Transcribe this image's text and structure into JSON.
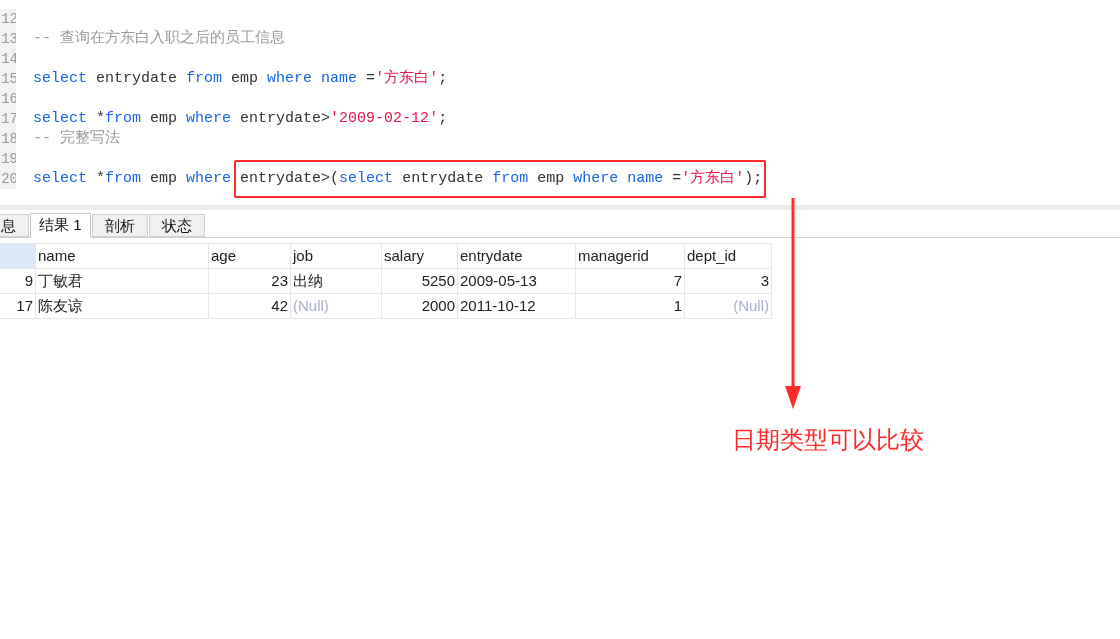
{
  "editor": {
    "lines": [
      {
        "number": "12"
      },
      {
        "number": "13",
        "tokens": [
          {
            "kind": "comment",
            "text": "-- 查询在方东白入职之后的员工信息"
          }
        ]
      },
      {
        "number": "14"
      },
      {
        "number": "15",
        "tokens": [
          {
            "kind": "keyword",
            "text": "select"
          },
          {
            "kind": "plain",
            "text": " entrydate "
          },
          {
            "kind": "keyword",
            "text": "from"
          },
          {
            "kind": "plain",
            "text": " emp "
          },
          {
            "kind": "keyword",
            "text": "where"
          },
          {
            "kind": "keyword",
            "text": " name"
          },
          {
            "kind": "plain",
            "text": " ="
          },
          {
            "kind": "string",
            "text": "'方东白'"
          },
          {
            "kind": "plain",
            "text": ";"
          }
        ]
      },
      {
        "number": "16"
      },
      {
        "number": "17",
        "tokens": [
          {
            "kind": "keyword",
            "text": "select"
          },
          {
            "kind": "plain",
            "text": " *"
          },
          {
            "kind": "keyword",
            "text": "from"
          },
          {
            "kind": "plain",
            "text": " emp "
          },
          {
            "kind": "keyword",
            "text": "where"
          },
          {
            "kind": "plain",
            "text": " entrydate>"
          },
          {
            "kind": "string",
            "text": "'2009-02-12'"
          },
          {
            "kind": "plain",
            "text": ";"
          }
        ]
      },
      {
        "number": "18",
        "tokens": [
          {
            "kind": "comment",
            "text": "-- 完整写法"
          }
        ]
      },
      {
        "number": "19"
      },
      {
        "number": "20",
        "tokens": [
          {
            "kind": "keyword",
            "text": "select"
          },
          {
            "kind": "plain",
            "text": " *"
          },
          {
            "kind": "keyword",
            "text": "from"
          },
          {
            "kind": "plain",
            "text": " emp "
          },
          {
            "kind": "keyword",
            "text": "where "
          }
        ],
        "boxed_tokens": [
          {
            "kind": "plain",
            "text": "entrydate>("
          },
          {
            "kind": "keyword",
            "text": "select"
          },
          {
            "kind": "plain",
            "text": " entrydate "
          },
          {
            "kind": "keyword",
            "text": "from"
          },
          {
            "kind": "plain",
            "text": " emp "
          },
          {
            "kind": "keyword",
            "text": "where"
          },
          {
            "kind": "keyword",
            "text": " name"
          },
          {
            "kind": "plain",
            "text": " ="
          },
          {
            "kind": "string",
            "text": "'方东白'"
          },
          {
            "kind": "plain",
            "text": ");"
          }
        ]
      }
    ]
  },
  "tabs": [
    {
      "label": "息",
      "selected": false
    },
    {
      "label": "结果 1",
      "selected": true
    },
    {
      "label": "剖析",
      "selected": false
    },
    {
      "label": "状态",
      "selected": false
    }
  ],
  "table": {
    "columns": [
      {
        "kind": "number"
      },
      {
        "label": "name",
        "kind": "text"
      },
      {
        "label": "age",
        "kind": "number"
      },
      {
        "label": "job",
        "kind": "text"
      },
      {
        "label": "salary",
        "kind": "number"
      },
      {
        "label": "entrydate",
        "kind": "text"
      },
      {
        "label": "managerid",
        "kind": "number"
      },
      {
        "label": "dept_id",
        "kind": "number"
      }
    ],
    "rows": [
      [
        {
          "text": "9",
          "kind": "value"
        },
        {
          "text": "丁敏君",
          "kind": "value"
        },
        {
          "text": "23",
          "kind": "value"
        },
        {
          "text": "出纳",
          "kind": "value"
        },
        {
          "text": "5250",
          "kind": "value"
        },
        {
          "text": "2009-05-13",
          "kind": "value"
        },
        {
          "text": "7",
          "kind": "value"
        },
        {
          "text": "3",
          "kind": "value"
        }
      ],
      [
        {
          "text": "17",
          "kind": "value"
        },
        {
          "text": "陈友谅",
          "kind": "value"
        },
        {
          "text": "42",
          "kind": "value"
        },
        {
          "text": "(Null)",
          "kind": "null"
        },
        {
          "text": "2000",
          "kind": "value"
        },
        {
          "text": "2011-10-12",
          "kind": "value"
        },
        {
          "text": "1",
          "kind": "value"
        },
        {
          "text": "(Null)",
          "kind": "null"
        }
      ]
    ]
  },
  "annotation": {
    "text": "日期类型可以比较"
  }
}
